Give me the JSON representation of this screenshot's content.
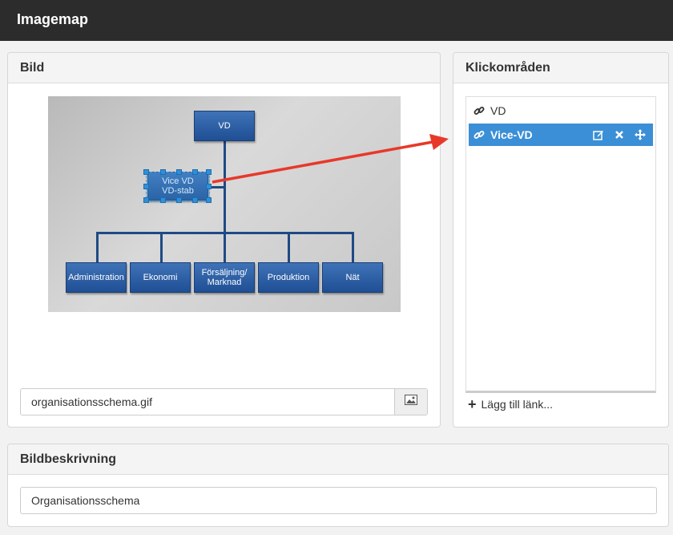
{
  "app": {
    "title": "Imagemap"
  },
  "bild": {
    "heading": "Bild",
    "filename": "organisationsschema.gif",
    "chart": {
      "top": "VD",
      "staff": [
        "Vice VD",
        "VD-stab"
      ],
      "departments": [
        "Administration",
        "Ekonomi",
        "Försäljning/ Marknad",
        "Produktion",
        "Nät"
      ]
    }
  },
  "klick": {
    "heading": "Klickområden",
    "items": [
      {
        "label": "VD",
        "active": false
      },
      {
        "label": "Vice-VD",
        "active": true
      }
    ],
    "add_link": "Lägg till länk..."
  },
  "desc": {
    "heading": "Bildbeskrivning",
    "value": "Organisationsschema"
  },
  "colors": {
    "accent": "#3b8fd6",
    "arrow": "#e8382a",
    "topbar": "#2c2c2c"
  },
  "icons": [
    "link-icon",
    "edit-icon",
    "close-icon",
    "move-icon",
    "image-icon",
    "plus-icon"
  ]
}
